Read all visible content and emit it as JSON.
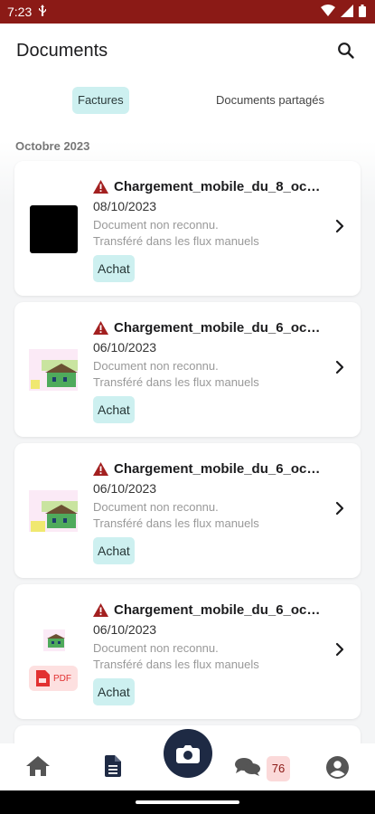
{
  "status_bar": {
    "time": "7:23"
  },
  "header": {
    "title": "Documents"
  },
  "tabs": [
    {
      "label": "Factures",
      "active": true
    },
    {
      "label": "Documents partagés",
      "active": false
    }
  ],
  "section": {
    "label": "Octobre 2023"
  },
  "documents": [
    {
      "title": "Chargement_mobile_du_8_oc…",
      "date": "08/10/2023",
      "status_line1": "Document non reconnu.",
      "status_line2": "Transféré dans les flux manuels",
      "tag": "Achat",
      "thumb": "black-square"
    },
    {
      "title": "Chargement_mobile_du_6_oc…",
      "date": "06/10/2023",
      "status_line1": "Document non reconnu.",
      "status_line2": "Transféré dans les flux manuels",
      "tag": "Achat",
      "thumb": "house-image"
    },
    {
      "title": "Chargement_mobile_du_6_oc…",
      "date": "06/10/2023",
      "status_line1": "Document non reconnu.",
      "status_line2": "Transféré dans les flux manuels",
      "tag": "Achat",
      "thumb": "house-image"
    },
    {
      "title": "Chargement_mobile_du_6_oc…",
      "date": "06/10/2023",
      "status_line1": "Document non reconnu.",
      "status_line2": "Transféré dans les flux manuels",
      "tag": "Achat",
      "thumb": "house-image-pdf",
      "pdf_label": "PDF"
    }
  ],
  "nav": {
    "messages_count": "76"
  },
  "colors": {
    "status_bar": "#8b1a16",
    "tag_bg": "#cdf0f0",
    "camera_bg": "#1e2a44",
    "warning": "#a32020"
  }
}
